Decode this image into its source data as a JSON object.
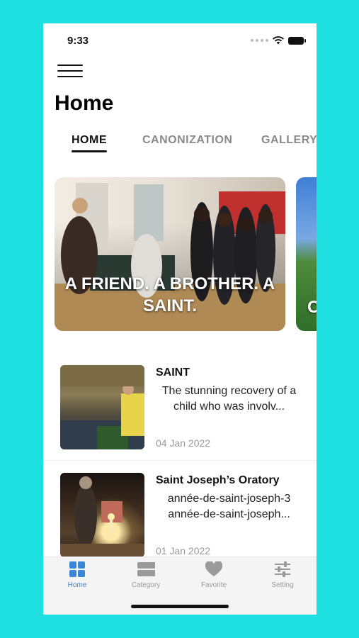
{
  "status_bar": {
    "time": "9:33"
  },
  "header": {
    "title": "Home"
  },
  "tabs": [
    {
      "label": "HOME",
      "active": true
    },
    {
      "label": "CANONIZATION",
      "active": false
    },
    {
      "label": "GALLERY",
      "active": false
    }
  ],
  "carousel": [
    {
      "caption": "A FRIEND. A BROTHER. A SAINT."
    },
    {
      "caption": "C"
    }
  ],
  "articles": [
    {
      "title": "SAINT",
      "description": "The stunning recovery of a child who was involv...",
      "date": "04 Jan 2022"
    },
    {
      "title": "Saint Joseph’s Oratory",
      "description": "année-de-saint-joseph-3 année-de-saint-joseph...",
      "date": "01 Jan 2022"
    }
  ],
  "bottom_nav": [
    {
      "label": "Home",
      "icon": "grid-icon",
      "active": true
    },
    {
      "label": "Category",
      "icon": "stack-icon",
      "active": false
    },
    {
      "label": "Favorite",
      "icon": "heart-icon",
      "active": false
    },
    {
      "label": "Setting",
      "icon": "sliders-icon",
      "active": false
    }
  ],
  "colors": {
    "background": "#1ee0e0",
    "accent": "#3a86d9",
    "inactive": "#9a9a9a"
  }
}
